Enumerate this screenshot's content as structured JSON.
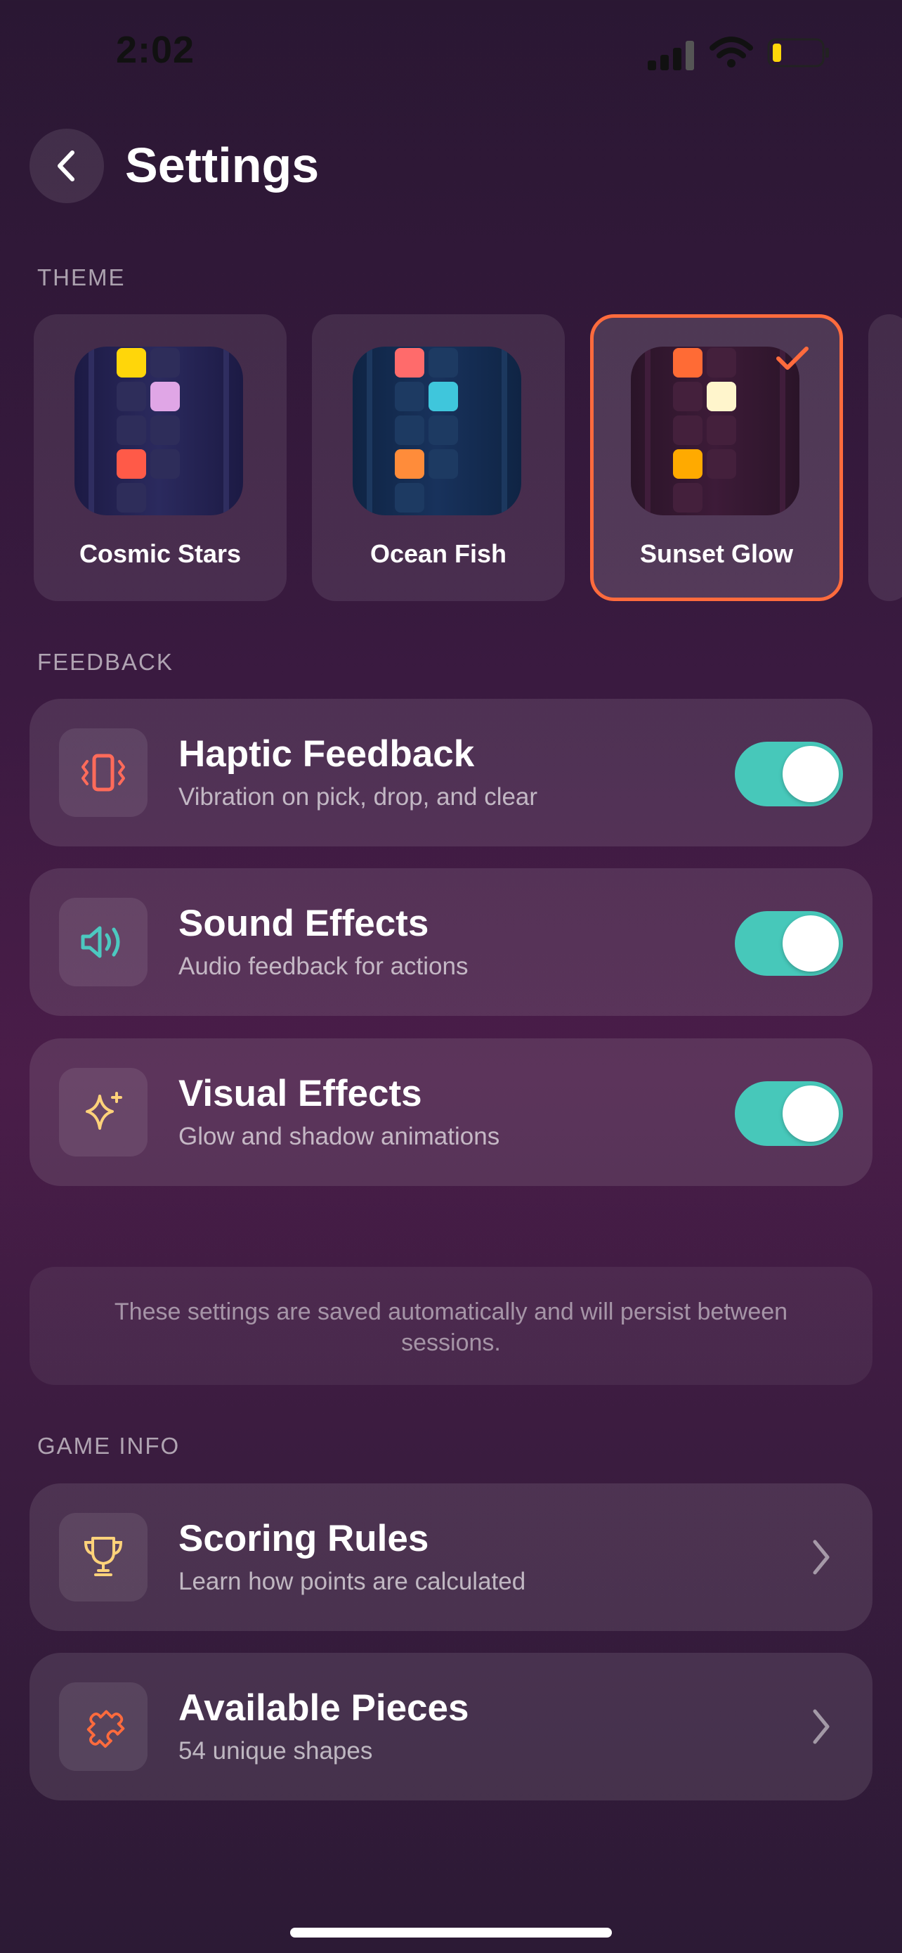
{
  "status_bar": {
    "time": "2:02"
  },
  "header": {
    "title": "Settings"
  },
  "sections": {
    "theme": "THEME",
    "feedback": "FEEDBACK",
    "game_info": "GAME INFO"
  },
  "themes": [
    {
      "name": "Cosmic Stars",
      "selected": false
    },
    {
      "name": "Ocean Fish",
      "selected": false
    },
    {
      "name": "Sunset Glow",
      "selected": true
    }
  ],
  "feedback": [
    {
      "title": "Haptic Feedback",
      "subtitle": "Vibration on pick, drop, and clear",
      "enabled": true,
      "icon": "vibration-icon"
    },
    {
      "title": "Sound Effects",
      "subtitle": "Audio feedback for actions",
      "enabled": true,
      "icon": "speaker-icon"
    },
    {
      "title": "Visual Effects",
      "subtitle": "Glow and shadow animations",
      "enabled": true,
      "icon": "sparkles-icon"
    }
  ],
  "note": "These settings are saved automatically and will persist between sessions.",
  "game_info": [
    {
      "title": "Scoring Rules",
      "subtitle": "Learn how points are calculated",
      "icon": "trophy-icon"
    },
    {
      "title": "Available Pieces",
      "subtitle": "54 unique shapes",
      "icon": "puzzle-icon"
    }
  ],
  "colors": {
    "accent": "#ff6b3d",
    "toggle_on": "#47c8ba"
  }
}
